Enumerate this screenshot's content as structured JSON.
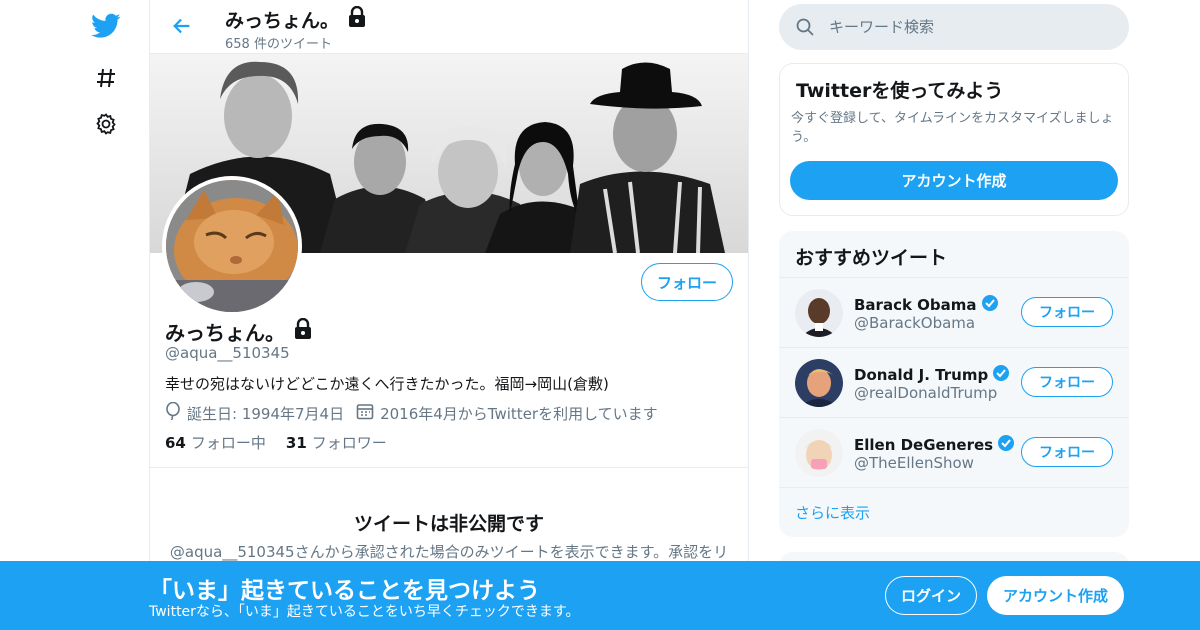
{
  "colors": {
    "accent": "#1da1f2",
    "muted": "#657786",
    "border": "#e6ecf0",
    "panel": "#f5f8fa"
  },
  "rail": {
    "icons": [
      "twitter-logo-icon",
      "hashtag-icon",
      "gear-icon"
    ]
  },
  "header": {
    "name": "みっちょん。",
    "tweet_count": "658 件のツイート"
  },
  "profile": {
    "name": "みっちょん。",
    "handle": "@aqua__510345",
    "bio": "幸せの宛はないけどどこか遠くへ行きたかった。福岡→岡山(倉敷)",
    "birthday": "誕生日: 1994年7月4日",
    "joined": "2016年4月からTwitterを利用しています",
    "following_count": "64",
    "following_label": "フォロー中",
    "followers_count": "31",
    "followers_label": "フォロワー",
    "follow_button": "フォロー"
  },
  "protected": {
    "title": "ツイートは非公開です",
    "text": "@aqua__510345さんから承認された場合のみツイートを表示できます。承認をリ"
  },
  "search": {
    "placeholder": "キーワード検索"
  },
  "signup_card": {
    "title": "Twitterを使ってみよう",
    "text": "今すぐ登録して、タイムラインをカスタマイズしましょう。",
    "button": "アカウント作成"
  },
  "recommend": {
    "title": "おすすめツイート",
    "items": [
      {
        "name": "Barack Obama",
        "handle": "@BarackObama",
        "button": "フォロー"
      },
      {
        "name": "Donald J. Trump",
        "handle": "@realDonaldTrump",
        "button": "フォロー"
      },
      {
        "name": "Ellen DeGeneres",
        "handle": "@TheEllenShow",
        "button": "フォロー"
      }
    ],
    "more": "さらに表示"
  },
  "bottom_bar": {
    "title": "「いま」起きていることを見つけよう",
    "subtitle": "Twitterなら、「いま」起きていることをいち早くチェックできます。",
    "login": "ログイン",
    "signup": "アカウント作成"
  }
}
